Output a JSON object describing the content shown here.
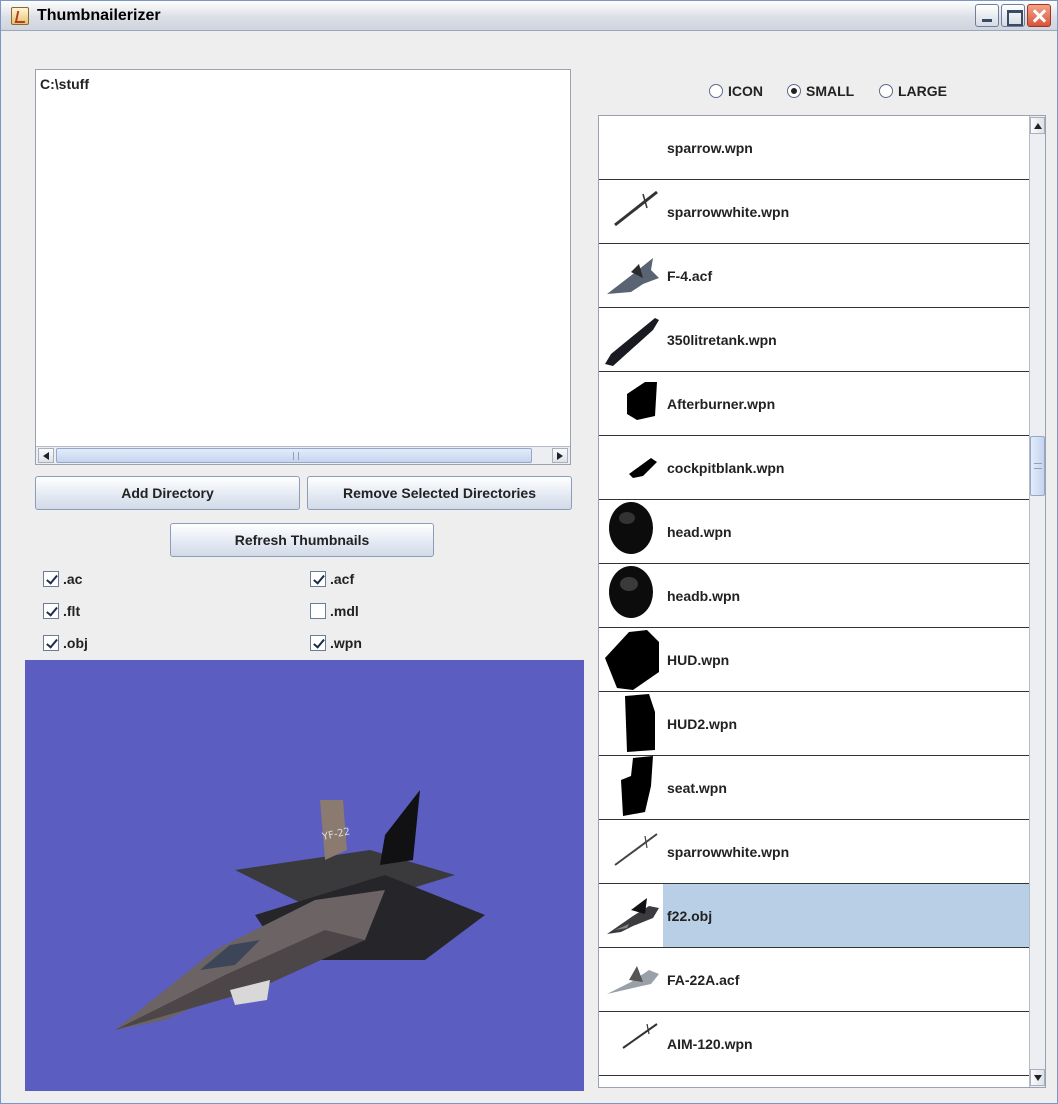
{
  "window": {
    "title": "Thumbnailerizer"
  },
  "directories": [
    "C:\\stuff"
  ],
  "buttons": {
    "add": "Add Directory",
    "remove": "Remove Selected Directories",
    "refresh": "Refresh Thumbnails"
  },
  "filters": [
    {
      "label": ".ac",
      "checked": true
    },
    {
      "label": ".acf",
      "checked": true
    },
    {
      "label": ".flt",
      "checked": true
    },
    {
      "label": ".mdl",
      "checked": false
    },
    {
      "label": ".obj",
      "checked": true
    },
    {
      "label": ".wpn",
      "checked": true
    }
  ],
  "size_options": {
    "icon": "ICON",
    "small": "SMALL",
    "large": "LARGE",
    "selected": "SMALL"
  },
  "preview": {
    "background": "#5c5dc0",
    "model": "f22.obj"
  },
  "thumbnails": [
    {
      "label": "sparrow.wpn",
      "icon": "none"
    },
    {
      "label": "sparrowwhite.wpn",
      "icon": "missile-icon"
    },
    {
      "label": "F-4.acf",
      "icon": "jet-icon"
    },
    {
      "label": "350litretank.wpn",
      "icon": "tank-icon"
    },
    {
      "label": "Afterburner.wpn",
      "icon": "block-icon"
    },
    {
      "label": "cockpitblank.wpn",
      "icon": "shard-icon"
    },
    {
      "label": "head.wpn",
      "icon": "helmet-icon"
    },
    {
      "label": "headb.wpn",
      "icon": "helmet-icon"
    },
    {
      "label": "HUD.wpn",
      "icon": "hud-icon"
    },
    {
      "label": "HUD2.wpn",
      "icon": "hud2-icon"
    },
    {
      "label": "seat.wpn",
      "icon": "seat-icon"
    },
    {
      "label": "sparrowwhite.wpn",
      "icon": "missile-icon"
    },
    {
      "label": "f22.obj",
      "icon": "jet-icon",
      "selected": true
    },
    {
      "label": "FA-22A.acf",
      "icon": "jet-icon"
    },
    {
      "label": "AIM-120.wpn",
      "icon": "missile-icon"
    }
  ],
  "colors": {
    "selection": "#b8cfe5",
    "preview_bg": "#5c5dc0"
  }
}
